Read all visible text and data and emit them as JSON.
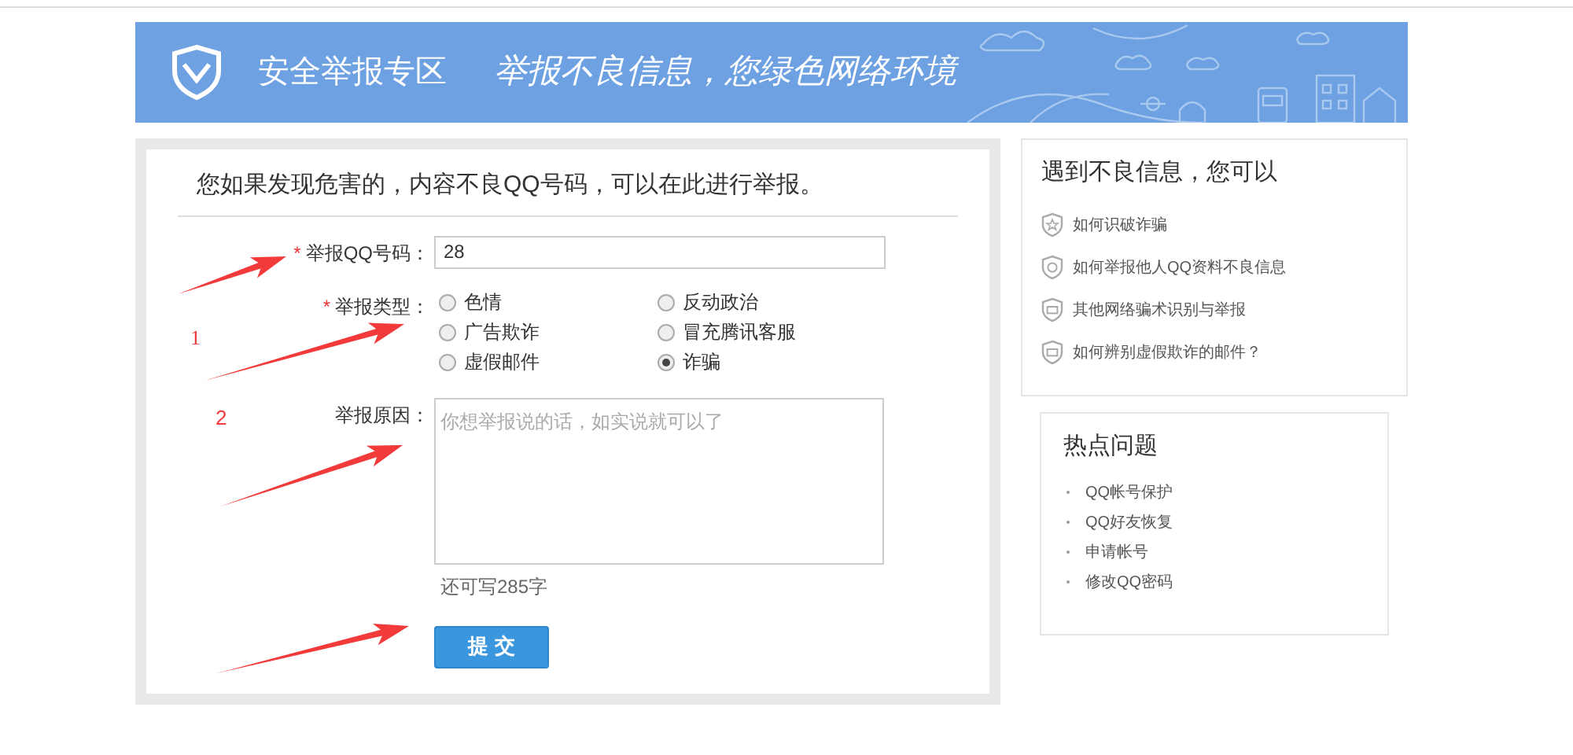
{
  "header": {
    "title": "安全举报专区",
    "slogan": "举报不良信息，您绿色网络环境"
  },
  "form": {
    "heading": "您如果发现危害的，内容不良QQ号码，可以在此进行举报。",
    "fields": [
      {
        "kind": "text",
        "marker": "*",
        "label": "举报QQ号码：",
        "value": "28"
      },
      {
        "kind": "radio",
        "marker": "*",
        "label": "举报类型：",
        "options": [
          {
            "label": "色情",
            "selected": false
          },
          {
            "label": "反动政治",
            "selected": false
          },
          {
            "label": "广告欺诈",
            "selected": false
          },
          {
            "label": "冒充腾讯客服",
            "selected": false
          },
          {
            "label": "虚假邮件",
            "selected": false
          },
          {
            "label": "诈骗",
            "selected": true
          }
        ]
      },
      {
        "kind": "textarea",
        "label": "举报原因：",
        "placeholder": "你想举报说的话，如实说就可以了",
        "counter": "还可写285字"
      }
    ],
    "submit": "提 交"
  },
  "sidebar": [
    {
      "title": "遇到不良信息，您可以",
      "items": [
        "如何识破诈骗",
        "如何举报他人QQ资料不良信息",
        "其他网络骗术识别与举报",
        "如何辨别虚假欺诈的邮件？"
      ]
    },
    {
      "title": "热点问题",
      "items": [
        "QQ帐号保护",
        "QQ好友恢复",
        "申请帐号",
        "修改QQ密码"
      ]
    }
  ],
  "annotations": [
    "1",
    "2"
  ]
}
